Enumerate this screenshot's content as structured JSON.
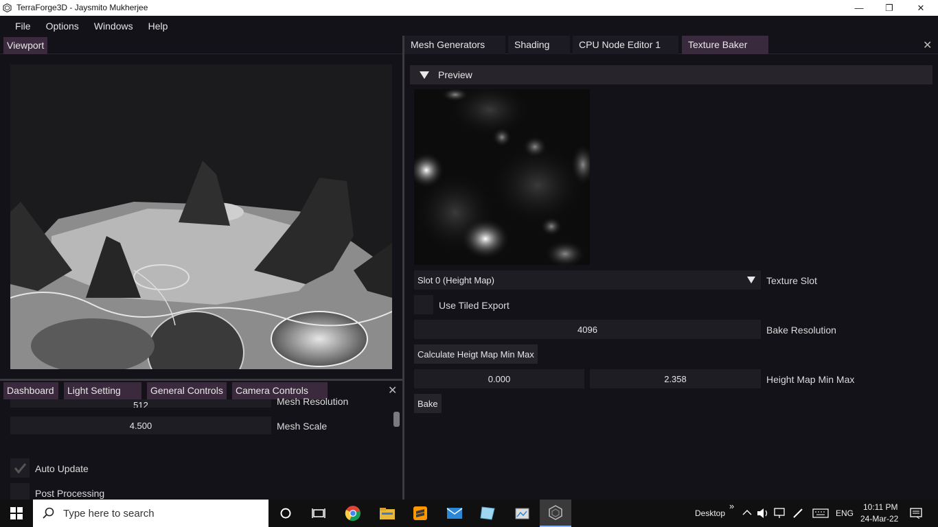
{
  "window": {
    "title": "TerraForge3D - Jaysmito Mukherjee",
    "minimize": "—",
    "restore": "❐",
    "close": "✕"
  },
  "menubar": {
    "items": [
      "File",
      "Options",
      "Windows",
      "Help"
    ]
  },
  "viewport_panel": {
    "tab": "Viewport"
  },
  "bottom_panel": {
    "tabs": [
      "Dashboard",
      "Light Setting",
      "General Controls",
      "Camera Controls"
    ],
    "close": "✕",
    "mesh_resolution_value": "512",
    "mesh_resolution_label": "Mesh Resolution",
    "mesh_scale_value": "4.500",
    "mesh_scale_label": "Mesh Scale",
    "auto_update_label": "Auto Update",
    "auto_update_checked": true,
    "post_processing_label": "Post Processing"
  },
  "right_panel": {
    "tabs": [
      "Mesh Generators",
      "Shading",
      "CPU Node Editor 1",
      "Texture Baker"
    ],
    "close": "✕",
    "preview_header": "Preview",
    "texture_slot_value": "Slot 0 (Height Map)",
    "texture_slot_label": "Texture Slot",
    "use_tiled_export_label": "Use Tiled Export",
    "bake_resolution_value": "4096",
    "bake_resolution_label": "Bake Resolution",
    "calc_button": "Calculate Heigt Map Min Max",
    "height_min": "0.000",
    "height_max": "2.358",
    "height_minmax_label": "Height Map Min Max",
    "bake_button": "Bake"
  },
  "taskbar": {
    "search_placeholder": "Type here to search",
    "desktop_label": "Desktop",
    "chevron": "»",
    "language": "ENG",
    "time": "10:11 PM",
    "date": "24-Mar-22"
  },
  "colors": {
    "panel_bg": "#121218",
    "active_tab": "#3b2a3e",
    "field_bg": "#1e1d23"
  }
}
